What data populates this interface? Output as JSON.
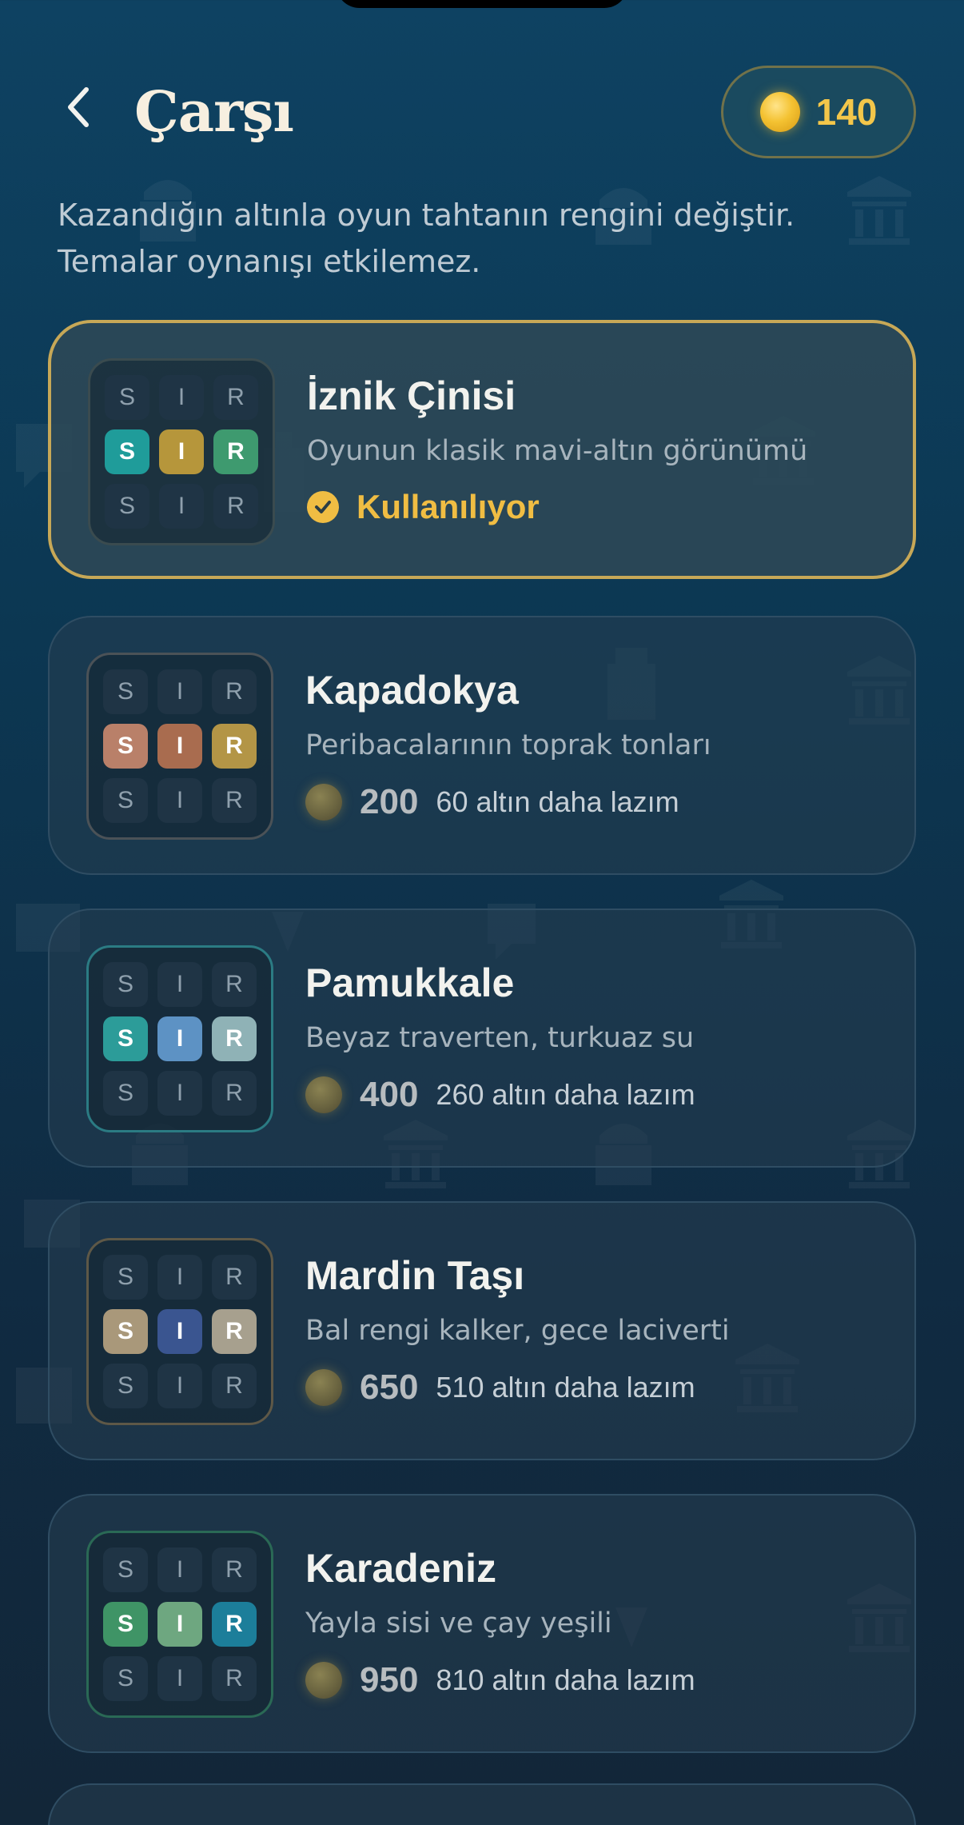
{
  "header": {
    "title": "Çarşı",
    "coins": "140"
  },
  "subtitle": "Kazandığın altınla oyun tahtanın rengini değiştir. Temalar oynanışı etkilemez.",
  "themes": [
    {
      "name": "İznik Çinisi",
      "desc": "Oyunun klasik mavi-altın görünümü",
      "status": "Kullanılıyor",
      "frame": "#3a4b4f",
      "letters": [
        "S",
        "I",
        "R"
      ],
      "colors": [
        "#1f9c9a",
        "#b6963b",
        "#3e9a6f"
      ]
    },
    {
      "name": "Kapadokya",
      "desc": "Peribacalarının toprak tonları",
      "price": "200",
      "need": "60 altın daha lazım",
      "frame": "#4b5257",
      "letters": [
        "S",
        "I",
        "R"
      ],
      "colors": [
        "#b98069",
        "#a96c4f",
        "#b39546"
      ]
    },
    {
      "name": "Pamukkale",
      "desc": "Beyaz traverten, turkuaz su",
      "price": "400",
      "need": "260 altın daha lazım",
      "frame": "#2b7b83",
      "letters": [
        "S",
        "I",
        "R"
      ],
      "colors": [
        "#2c9c99",
        "#5d92c4",
        "#8fb2b6"
      ]
    },
    {
      "name": "Mardin Taşı",
      "desc": "Bal rengi kalker, gece laciverti",
      "price": "650",
      "need": "510 altın daha lazım",
      "frame": "#5e5847",
      "letters": [
        "S",
        "I",
        "R"
      ],
      "colors": [
        "#a9987a",
        "#3a5590",
        "#a7a08e"
      ]
    },
    {
      "name": "Karadeniz",
      "desc": "Yayla sisi ve çay yeşili",
      "price": "950",
      "need": "810 altın daha lazım",
      "frame": "#2a6955",
      "letters": [
        "S",
        "I",
        "R"
      ],
      "colors": [
        "#3f9466",
        "#6ea780",
        "#1c7e9a"
      ]
    }
  ]
}
